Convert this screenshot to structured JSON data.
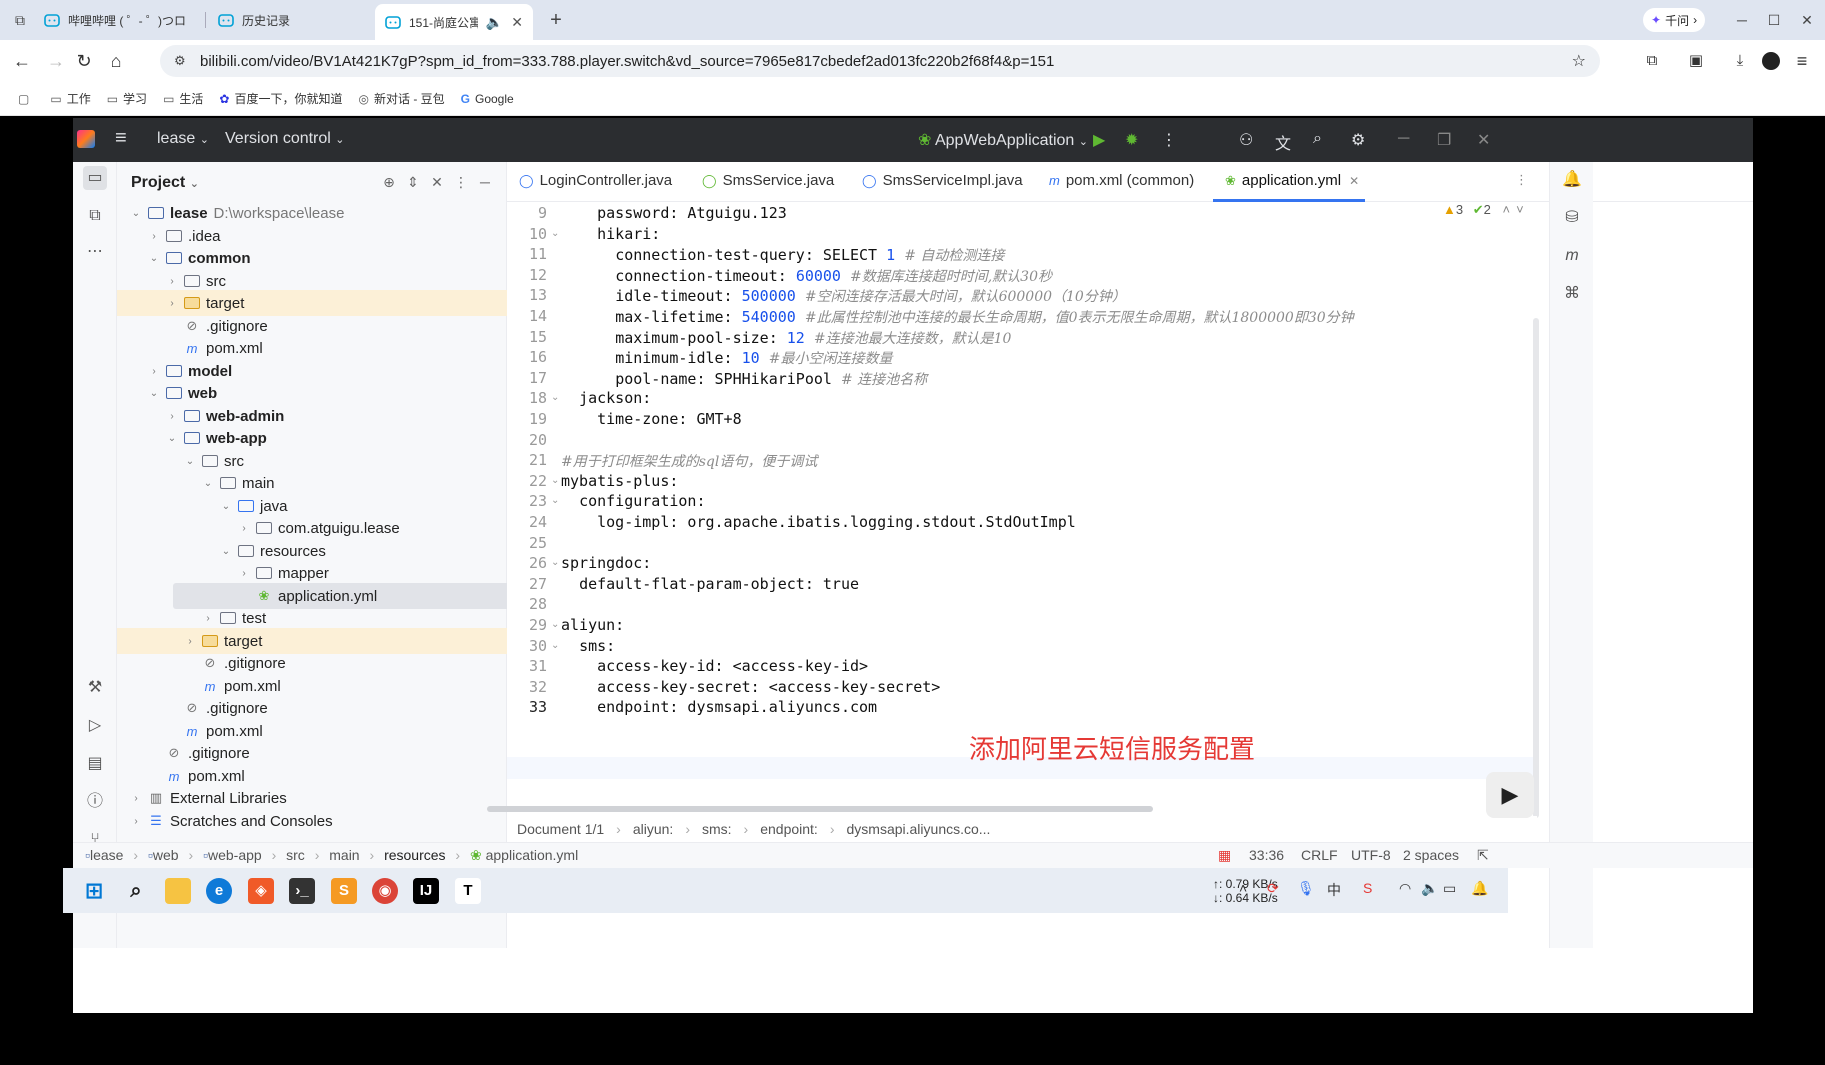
{
  "browser": {
    "tabs": [
      {
        "label": "哔哩哔哩 ( ゜- ゜)つロ",
        "active": false
      },
      {
        "label": "历史记录",
        "active": false
      },
      {
        "label": "151-尚庭公寓",
        "active": true
      }
    ],
    "new_tab": "+",
    "profile_label": "千问",
    "url": "bilibili.com/video/BV1At421K7gP?spm_id_from=333.788.player.switch&vd_source=7965e817cbedef2ad013fc220b2f68f4&p=151",
    "bookmarks": [
      "工作",
      "学习",
      "生活",
      "百度一下，你就知道",
      "新对话 - 豆包",
      "Google"
    ]
  },
  "ide": {
    "project_name": "lease",
    "version_control": "Version control",
    "run_config": "AppWebApplication",
    "project_panel_title": "Project",
    "tree": [
      {
        "label": "lease",
        "path": "D:\\workspace\\lease",
        "bold": true
      },
      {
        "label": ".idea"
      },
      {
        "label": "common",
        "bold": true
      },
      {
        "label": "src"
      },
      {
        "label": "target"
      },
      {
        "label": ".gitignore"
      },
      {
        "label": "pom.xml"
      },
      {
        "label": "model",
        "bold": true
      },
      {
        "label": "web",
        "bold": true
      },
      {
        "label": "web-admin",
        "bold": true
      },
      {
        "label": "web-app",
        "bold": true
      },
      {
        "label": "src"
      },
      {
        "label": "main"
      },
      {
        "label": "java"
      },
      {
        "label": "com.atguigu.lease"
      },
      {
        "label": "resources"
      },
      {
        "label": "mapper"
      },
      {
        "label": "application.yml"
      },
      {
        "label": "test"
      },
      {
        "label": "target"
      },
      {
        "label": ".gitignore"
      },
      {
        "label": "pom.xml"
      },
      {
        "label": ".gitignore"
      },
      {
        "label": "pom.xml"
      },
      {
        "label": ".gitignore"
      },
      {
        "label": "pom.xml"
      },
      {
        "label": "External Libraries"
      },
      {
        "label": "Scratches and Consoles"
      }
    ],
    "editor_tabs": [
      "LoginController.java",
      "SmsService.java",
      "SmsServiceImpl.java",
      "pom.xml (common)",
      "application.yml"
    ],
    "inspections": {
      "warnings": "3",
      "ok": "2"
    },
    "code_lines": [
      {
        "n": "9",
        "text": "    password: Atguigu.123"
      },
      {
        "n": "10",
        "text": "    hikari:"
      },
      {
        "n": "11",
        "text": "      connection-test-query: SELECT 1 # 自动检测连接"
      },
      {
        "n": "12",
        "text": "      connection-timeout: 60000 #数据库连接超时时间,默认30秒"
      },
      {
        "n": "13",
        "text": "      idle-timeout: 500000 #空闲连接存活最大时间，默认600000（10分钟）"
      },
      {
        "n": "14",
        "text": "      max-lifetime: 540000 #此属性控制池中连接的最长生命周期，值0表示无限生命周期，默认1800000即30分钟"
      },
      {
        "n": "15",
        "text": "      maximum-pool-size: 12 #连接池最大连接数，默认是10"
      },
      {
        "n": "16",
        "text": "      minimum-idle: 10 #最小空闲连接数量"
      },
      {
        "n": "17",
        "text": "      pool-name: SPHHikariPool # 连接池名称"
      },
      {
        "n": "18",
        "text": "  jackson:"
      },
      {
        "n": "19",
        "text": "    time-zone: GMT+8"
      },
      {
        "n": "20",
        "text": ""
      },
      {
        "n": "21",
        "text": "#用于打印框架生成的sql语句，便于调试"
      },
      {
        "n": "22",
        "text": "mybatis-plus:"
      },
      {
        "n": "23",
        "text": "  configuration:"
      },
      {
        "n": "24",
        "text": "    log-impl: org.apache.ibatis.logging.stdout.StdOutImpl"
      },
      {
        "n": "25",
        "text": ""
      },
      {
        "n": "26",
        "text": "springdoc:"
      },
      {
        "n": "27",
        "text": "  default-flat-param-object: true"
      },
      {
        "n": "28",
        "text": ""
      },
      {
        "n": "29",
        "text": "aliyun:"
      },
      {
        "n": "30",
        "text": "  sms:"
      },
      {
        "n": "31",
        "text": "    access-key-id: <access-key-id>"
      },
      {
        "n": "32",
        "text": "    access-key-secret: <access-key-secret>"
      },
      {
        "n": "33",
        "text": "    endpoint: dysmsapi.aliyuncs.com"
      }
    ],
    "annotation": "添加阿里云短信服务配置",
    "doc_breadcrumb": [
      "Document 1/1",
      "aliyun:",
      "sms:",
      "endpoint:",
      "dysmsapi.aliyuncs.co..."
    ],
    "status_breadcrumb": [
      "lease",
      "web",
      "web-app",
      "src",
      "main",
      "resources",
      "application.yml"
    ],
    "status": {
      "position": "33:36",
      "line_sep": "CRLF",
      "encoding": "UTF-8",
      "indent": "2 spaces"
    }
  },
  "taskbar": {
    "net_up": "↑: 0.79 KB/s",
    "net_down": "↓: 0.64 KB/s"
  },
  "colors": {
    "accent": "#3574f0",
    "annotation": "#e53935",
    "ide_header": "#2b2d30"
  }
}
